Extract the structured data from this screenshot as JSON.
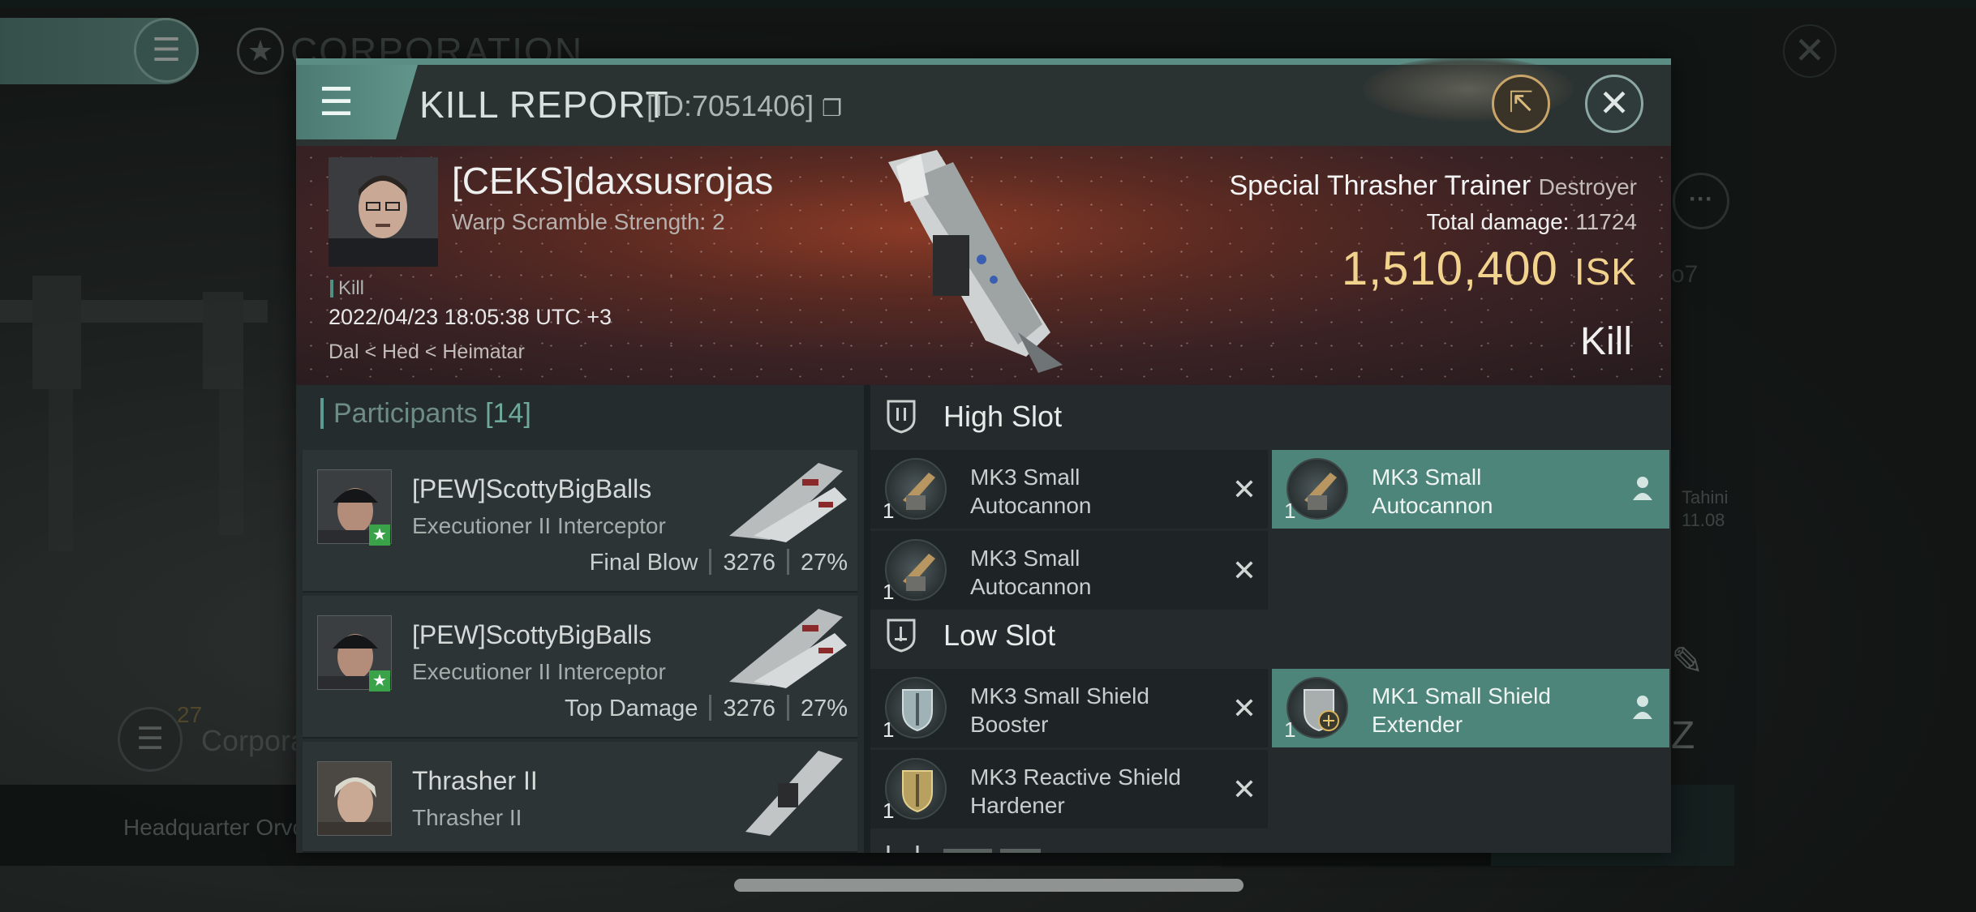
{
  "background": {
    "corp_title": "CORPORATION",
    "corp_button_count": "27",
    "corp_button_label": "Corpora",
    "hq_label": "Headquarter Orvo",
    "side_o7": "o7",
    "side_tahini": "Tahini",
    "side_date": "11.08"
  },
  "header": {
    "title": "KILL REPORT",
    "id_text": "[ID:7051406]"
  },
  "victim": {
    "name": "[CEKS]daxsusrojas",
    "sub": "Warp Scramble Strength: 2",
    "tag": "Kill",
    "datetime": "2022/04/23 18:05:38 UTC +3",
    "location": "Dal < Hed < Heimatar",
    "ship_name": "Special Thrasher Trainer",
    "ship_class": "Destroyer",
    "total_damage_label": "Total damage:",
    "total_damage": "11724",
    "isk_value": "1,510,400",
    "isk_unit": "ISK",
    "result": "Kill"
  },
  "participants": {
    "label": "Participants",
    "count": "[14]",
    "rows": [
      {
        "name": "[PEW]ScottyBigBalls",
        "ship": "Executioner II Interceptor",
        "stat_label": "Final Blow",
        "damage": "3276",
        "percent": "27%"
      },
      {
        "name": "[PEW]ScottyBigBalls",
        "ship": "Executioner II Interceptor",
        "stat_label": "Top Damage",
        "damage": "3276",
        "percent": "27%"
      },
      {
        "name": "Thrasher II",
        "ship": "Thrasher II"
      }
    ]
  },
  "slots": {
    "high_label": "High Slot",
    "low_label": "Low Slot",
    "high": [
      {
        "qty": "1",
        "line1": "MK3 Small",
        "line2": "Autocannon",
        "state": "destroyed"
      },
      {
        "qty": "1",
        "line1": "MK3 Small",
        "line2": "Autocannon",
        "state": "dropped"
      },
      {
        "qty": "1",
        "line1": "MK3 Small",
        "line2": "Autocannon",
        "state": "destroyed"
      }
    ],
    "low": [
      {
        "qty": "1",
        "line1": "MK3 Small Shield",
        "line2": "Booster",
        "state": "destroyed"
      },
      {
        "qty": "1",
        "line1": "MK1 Small Shield",
        "line2": "Extender",
        "state": "dropped"
      },
      {
        "qty": "1",
        "line1": "MK3 Reactive Shield",
        "line2": "Hardener",
        "state": "destroyed"
      }
    ]
  },
  "colors": {
    "accent": "#4e857b",
    "isk": "#f2d38e",
    "banner": "#5a2a22"
  }
}
